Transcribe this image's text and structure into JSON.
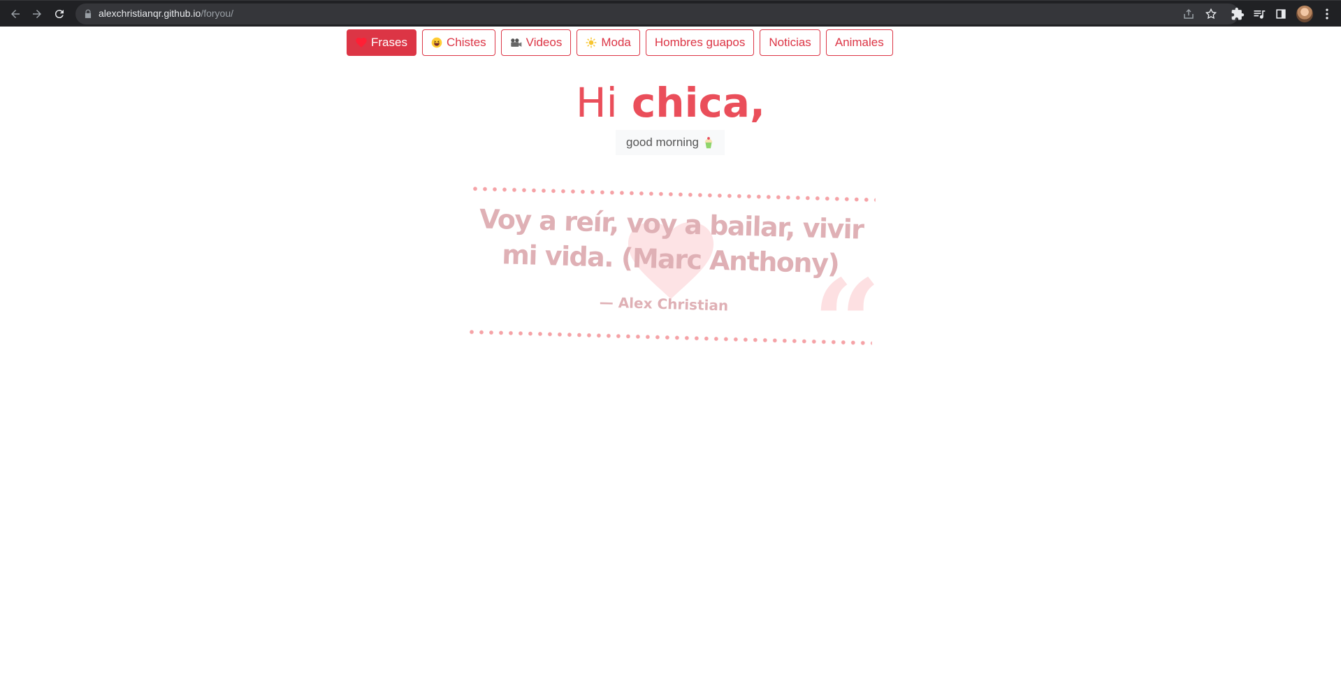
{
  "browser": {
    "url_host": "alexchristianqr.github.io",
    "url_path": "/foryou/"
  },
  "tabs": [
    {
      "label": "Frases",
      "icon": "heart-icon",
      "active": true
    },
    {
      "label": "Chistes",
      "icon": "laughing-face-icon",
      "active": false
    },
    {
      "label": "Videos",
      "icon": "video-camera-icon",
      "active": false
    },
    {
      "label": "Moda",
      "icon": "sun-icon",
      "active": false
    },
    {
      "label": "Hombres guapos",
      "icon": "",
      "active": false
    },
    {
      "label": "Noticias",
      "icon": "",
      "active": false
    },
    {
      "label": "Animales",
      "icon": "",
      "active": false
    }
  ],
  "hero": {
    "greeting_light": "Hi",
    "greeting_bold": "chica,"
  },
  "greeting_badge": {
    "text": "good morning",
    "icon": "cupcake-icon"
  },
  "quote": {
    "text": "Voy a reír, voy a bailar, vivir mi vida. (Marc Anthony)",
    "author": "— Alex Christian"
  },
  "colors": {
    "accent": "#dc3545",
    "hero": "#ea4e5a",
    "quote": "#dfb0b5",
    "dots": "#f5a2a6"
  }
}
